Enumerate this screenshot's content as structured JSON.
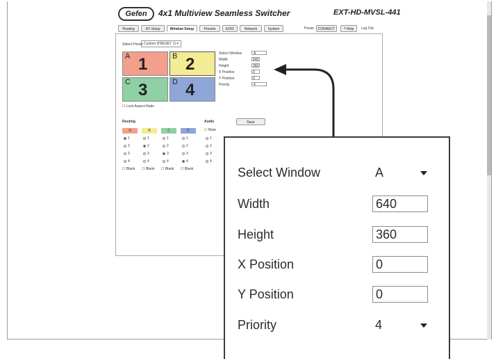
{
  "header": {
    "logo": "Gefen",
    "title": "4x1 Multiview Seamless Switcher",
    "model": "EXT-HD-MVSL-441"
  },
  "tabs": [
    "Routing",
    "I/O Setup",
    "Window Setup",
    "Presets",
    "EDID",
    "Network",
    "System"
  ],
  "active_tab": "Window Setup",
  "toolbar": {
    "power": "Power",
    "power_btn": "CONNECT",
    "help": "? Help",
    "logout": "Log Out"
  },
  "preset": {
    "label": "Select Preset",
    "value": "Custom (PRESET 1)"
  },
  "windows": [
    {
      "letter": "A",
      "number": "1",
      "color": "#f2a08c"
    },
    {
      "letter": "B",
      "number": "2",
      "color": "#f4ec94"
    },
    {
      "letter": "C",
      "number": "3",
      "color": "#8fd0a4"
    },
    {
      "letter": "D",
      "number": "4",
      "color": "#8ea6d8"
    }
  ],
  "mini_settings": {
    "select_window": "Select Window",
    "select_window_value": "A",
    "width": "Width",
    "width_value": "640",
    "height": "Height",
    "height_value": "360",
    "x_position": "X Position",
    "x_value": "0",
    "y_position": "Y Position",
    "y_value": "0",
    "priority": "Priority",
    "priority_value": "4"
  },
  "lock_aspect": "Lock Aspect Ratio",
  "routing_label": "Routing",
  "audio_label": "Audio",
  "save_label": "Save",
  "mute_label": "Mute",
  "routing_cols": [
    "A",
    "B",
    "C",
    "D"
  ],
  "routing_rows": [
    "1",
    "2",
    "3",
    "4"
  ],
  "blank_label": "Blank",
  "zoom": {
    "select_window_label": "Select Window",
    "select_window_value": "A",
    "width_label": "Width",
    "width_value": "640",
    "height_label": "Height",
    "height_value": "360",
    "x_label": "X Position",
    "x_value": "0",
    "y_label": "Y Position",
    "y_value": "0",
    "priority_label": "Priority",
    "priority_value": "4"
  }
}
